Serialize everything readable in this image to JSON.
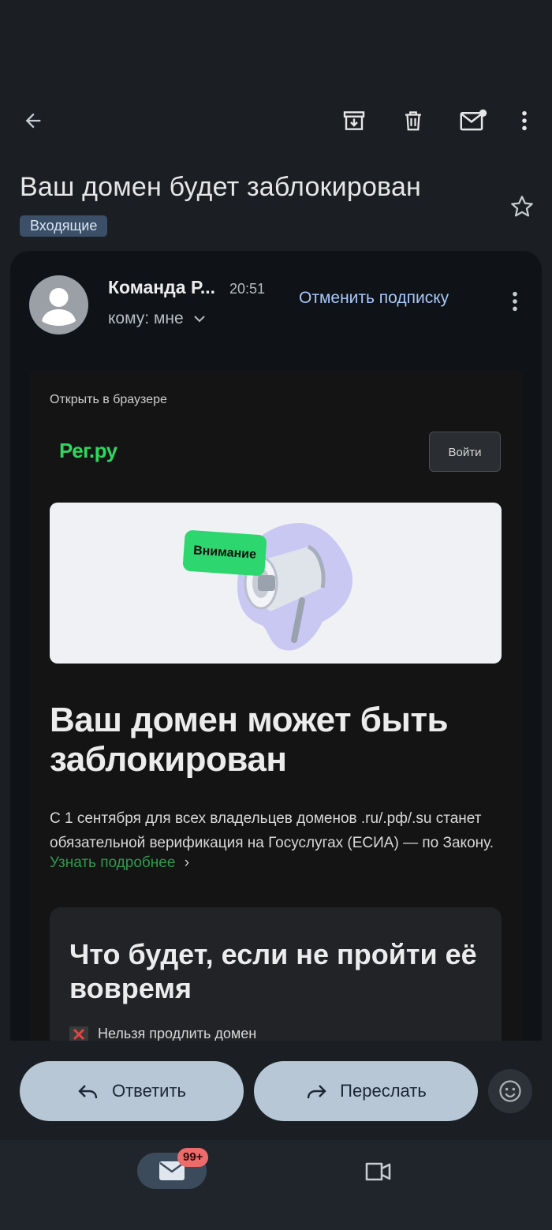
{
  "toolbar": {
    "back_icon": "arrow-left-icon",
    "archive_icon": "archive-icon",
    "delete_icon": "trash-icon",
    "mark_unread_icon": "mail-unread-icon",
    "more_icon": "more-vert-icon"
  },
  "subject": "Ваш домен будет заблокирован",
  "label": "Входящие",
  "message": {
    "sender": "Команда Р...",
    "time": "20:51",
    "recipient": "кому: мне",
    "unsubscribe": "Отменить подписку"
  },
  "email_body": {
    "open_in_browser": "Открыть в браузере",
    "logo_text": "Рег.ру",
    "login_button": "Войти",
    "banner_badge": "Внимание",
    "headline": "Ваш домен может быть заблокирован",
    "paragraph": "С 1 сентября для всех владельцев доменов .ru/.рф/.su станет обязательной верификация на Госуслугах (ЕСИА) — по Закону.",
    "more_link": "Узнать подробнее",
    "more_link_arrow": "›",
    "box_title": "Что будет, если не пройти её вовремя",
    "box_item_1": "Нельзя продлить домен"
  },
  "actions": {
    "reply": "Ответить",
    "forward": "Переслать"
  },
  "bottom_nav": {
    "mail_badge": "99+"
  },
  "colors": {
    "background": "#1b1f24",
    "accent_link": "#a8c7fa",
    "brand_green": "#2fd75e",
    "action_button": "#b7c7d6"
  }
}
